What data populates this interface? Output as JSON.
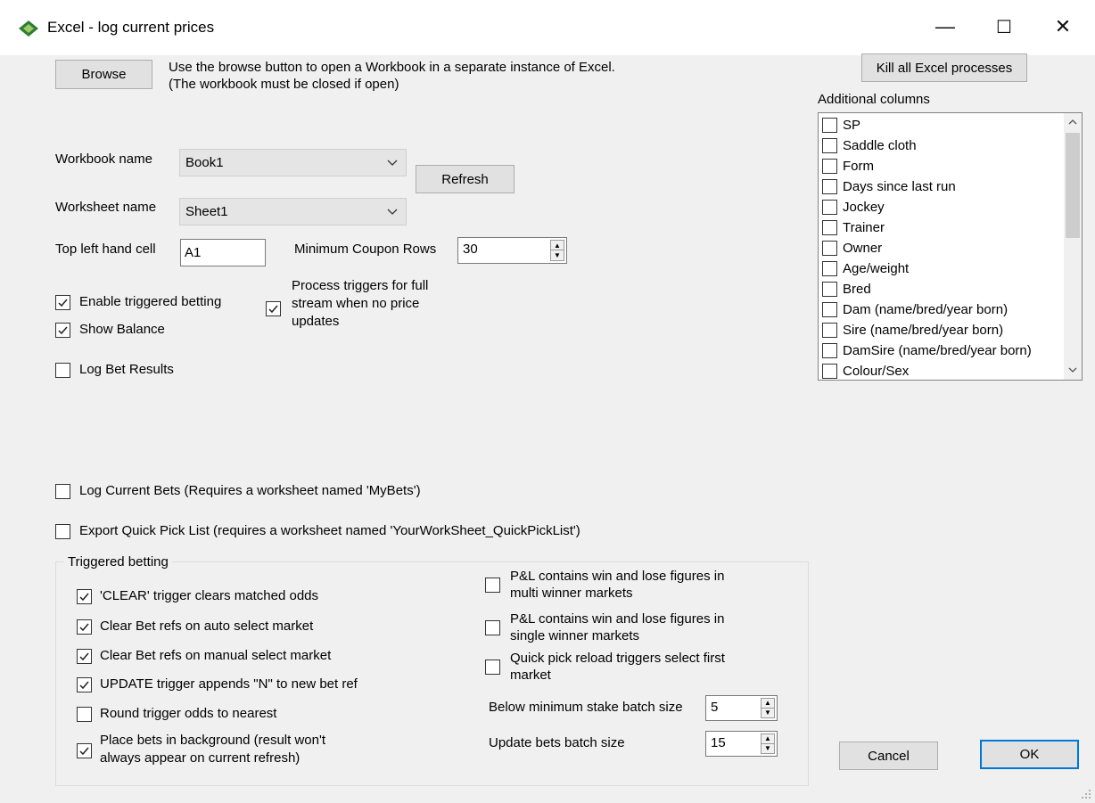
{
  "window": {
    "title": "Excel - log current prices",
    "minimize": "—",
    "maximize": "☐",
    "close": "✕"
  },
  "browse": {
    "label": "Browse",
    "help_line1": "Use the browse button to open a Workbook in a separate instance of Excel.",
    "help_line2": "(The workbook must be closed if open)"
  },
  "kill_button": "Kill all Excel processes",
  "workbook": {
    "label": "Workbook name",
    "value": "Book1"
  },
  "refresh_button": "Refresh",
  "worksheet": {
    "label": "Worksheet name",
    "value": "Sheet1"
  },
  "top_left": {
    "label": "Top left hand cell",
    "value": "A1"
  },
  "min_coupon": {
    "label": "Minimum Coupon Rows",
    "value": "30"
  },
  "checks_main": {
    "enable_triggered": {
      "label": "Enable triggered betting",
      "checked": true
    },
    "show_balance": {
      "label": "Show Balance",
      "checked": true
    },
    "log_bet_results": {
      "label": "Log Bet Results",
      "checked": false
    },
    "process_triggers": {
      "line1": "Process triggers for full",
      "line2": "stream when no price",
      "line3": "updates",
      "checked": true
    },
    "log_current_bets": {
      "label": "Log Current Bets (Requires a worksheet named 'MyBets')",
      "checked": false
    },
    "export_quick_pick": {
      "label": "Export Quick Pick List (requires a worksheet named 'YourWorkSheet_QuickPickList')",
      "checked": false
    }
  },
  "additional_columns": {
    "label": "Additional columns",
    "items": [
      "SP",
      "Saddle cloth",
      "Form",
      "Days since last run",
      "Jockey",
      "Trainer",
      "Owner",
      "Age/weight",
      "Bred",
      "Dam (name/bred/year born)",
      "Sire (name/bred/year born)",
      "DamSire (name/bred/year born)",
      "Colour/Sex"
    ]
  },
  "triggered_group": {
    "title": "Triggered betting",
    "left": [
      {
        "line1": "'CLEAR' trigger clears matched odds",
        "checked": true
      },
      {
        "line1": "Clear Bet refs on auto select market",
        "checked": true
      },
      {
        "line1": "Clear Bet refs on manual select market",
        "checked": true
      },
      {
        "line1": "UPDATE trigger appends \"N\" to new bet ref",
        "checked": true
      },
      {
        "line1": "Round trigger odds to nearest",
        "checked": false
      },
      {
        "line1": "Place bets in background (result won't",
        "line2": "always appear on current refresh)",
        "checked": true
      }
    ],
    "right": [
      {
        "line1": "P&L contains win and lose figures in",
        "line2": "multi winner markets",
        "checked": false
      },
      {
        "line1": "P&L contains win and lose figures in",
        "line2": "single winner markets",
        "checked": false
      },
      {
        "line1": "Quick pick reload triggers select first",
        "line2": "market",
        "checked": false
      }
    ],
    "below_min_stake": {
      "label": "Below minimum stake batch size",
      "value": "5"
    },
    "update_bets": {
      "label": "Update bets batch size",
      "value": "15"
    }
  },
  "cancel_button": "Cancel",
  "ok_button": "OK"
}
